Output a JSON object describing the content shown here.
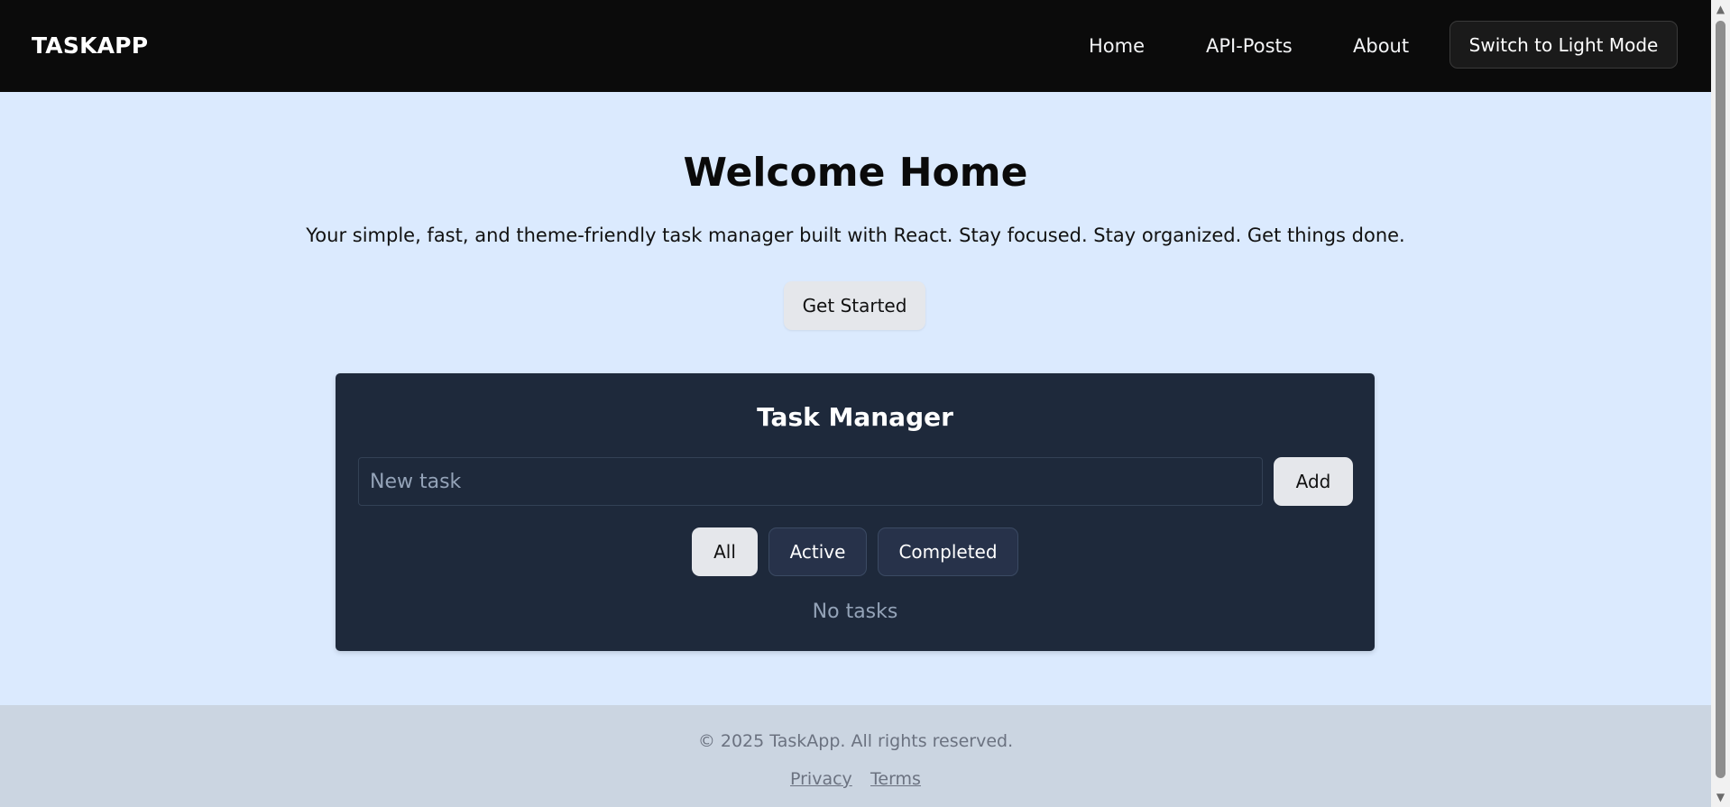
{
  "navbar": {
    "brand": "TASKAPP",
    "links": [
      {
        "label": "Home"
      },
      {
        "label": "API-Posts"
      },
      {
        "label": "About"
      }
    ],
    "theme_toggle_label": "Switch to Light Mode"
  },
  "hero": {
    "title": "Welcome Home",
    "subtitle": "Your simple, fast, and theme-friendly task manager built with React. Stay focused. Stay organized. Get things done.",
    "cta_label": "Get Started"
  },
  "task_manager": {
    "title": "Task Manager",
    "input_placeholder": "New task",
    "input_value": "",
    "add_label": "Add",
    "filters": [
      {
        "label": "All",
        "selected": true
      },
      {
        "label": "Active",
        "selected": false
      },
      {
        "label": "Completed",
        "selected": false
      }
    ],
    "empty_message": "No tasks"
  },
  "footer": {
    "copyright": "© 2025 TaskApp. All rights reserved.",
    "links": [
      {
        "label": "Privacy"
      },
      {
        "label": "Terms"
      }
    ]
  },
  "scrollbar": {
    "up_icon": "▲",
    "down_icon": "▼"
  },
  "colors": {
    "navbar_bg": "#0b0b0b",
    "page_bg": "#dbeafe",
    "card_bg": "#1e293b",
    "footer_bg": "#cbd5e1",
    "button_light": "#e5e7eb"
  }
}
